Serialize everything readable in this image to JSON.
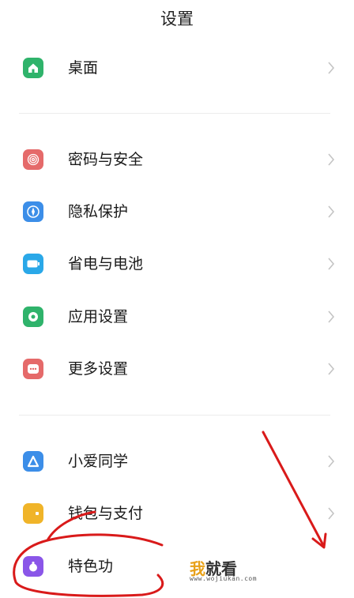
{
  "header": {
    "title": "设置"
  },
  "groups": [
    {
      "items": [
        {
          "label": "桌面",
          "icon": "home-icon",
          "color": "#2fb36b"
        }
      ]
    },
    {
      "items": [
        {
          "label": "密码与安全",
          "icon": "fingerprint-icon",
          "color": "#e56a6a"
        },
        {
          "label": "隐私保护",
          "icon": "compass-icon",
          "color": "#3c8ee8"
        },
        {
          "label": "省电与电池",
          "icon": "battery-icon",
          "color": "#2aa8e8"
        },
        {
          "label": "应用设置",
          "icon": "gear-icon",
          "color": "#2fb36b"
        },
        {
          "label": "更多设置",
          "icon": "more-icon",
          "color": "#e56a6a"
        }
      ]
    },
    {
      "items": [
        {
          "label": "小爱同学",
          "icon": "assistant-icon",
          "color": "#3c8ee8"
        },
        {
          "label": "钱包与支付",
          "icon": "wallet-icon",
          "color": "#f0b429"
        },
        {
          "label": "特色功",
          "icon": "feature-icon",
          "color": "#8a56e8"
        }
      ]
    }
  ],
  "watermark": {
    "accent": "我",
    "text": "就看",
    "url": "www.wojiukan.com"
  },
  "annotations": {
    "circle_color": "#d91a1a",
    "arrow_color": "#d91a1a"
  }
}
